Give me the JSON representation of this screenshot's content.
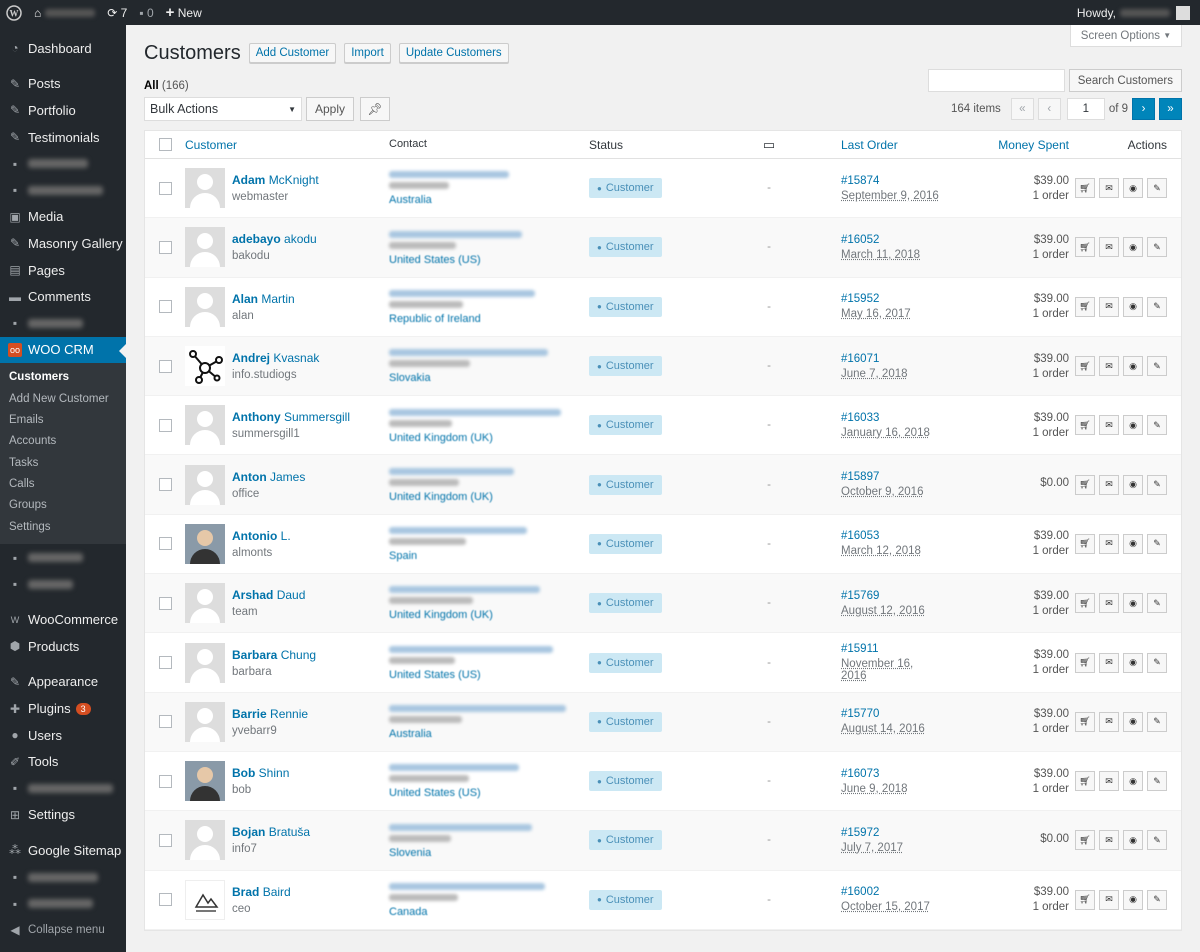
{
  "adminbar": {
    "updates_count": "7",
    "comments_count": "0",
    "new_label": "New",
    "howdy": "Howdy,"
  },
  "sidebar": {
    "items": [
      {
        "label": "Dashboard",
        "icon": "dashboard-icon"
      },
      {
        "label": "Posts",
        "icon": "pin-icon"
      },
      {
        "label": "Portfolio",
        "icon": "pin-icon"
      },
      {
        "label": "Testimonials",
        "icon": "pin-icon"
      },
      {
        "label": "Media",
        "icon": "media-icon"
      },
      {
        "label": "Masonry Gallery",
        "icon": "pin-icon"
      },
      {
        "label": "Pages",
        "icon": "pages-icon"
      },
      {
        "label": "Comments",
        "icon": "comment-icon"
      },
      {
        "label": "WOO CRM",
        "icon": "woocrm-icon"
      },
      {
        "label": "WooCommerce",
        "icon": "woo-icon"
      },
      {
        "label": "Products",
        "icon": "box-icon"
      },
      {
        "label": "Appearance",
        "icon": "brush-icon"
      },
      {
        "label": "Plugins",
        "icon": "plug-icon",
        "badge": "3"
      },
      {
        "label": "Users",
        "icon": "user-icon"
      },
      {
        "label": "Tools",
        "icon": "wrench-icon"
      },
      {
        "label": "Settings",
        "icon": "settings-icon"
      },
      {
        "label": "Google Sitemap",
        "icon": "sitemap-icon"
      },
      {
        "label": "Collapse menu",
        "icon": "collapse-icon"
      }
    ],
    "submenu": [
      "Customers",
      "Add New Customer",
      "Emails",
      "Accounts",
      "Tasks",
      "Calls",
      "Groups",
      "Settings"
    ]
  },
  "page": {
    "title": "Customers",
    "add_customer": "Add Customer",
    "import": "Import",
    "update_customers": "Update Customers",
    "screen_options": "Screen Options",
    "search_button": "Search Customers",
    "all_label": "All",
    "all_count": "(166)",
    "bulk_actions": "Bulk Actions",
    "apply": "Apply",
    "items_count": "164 items",
    "page_current": "1",
    "page_total": "of 9"
  },
  "table": {
    "headers": {
      "customer": "Customer",
      "contact": "Contact",
      "status": "Status",
      "last_order": "Last Order",
      "money_spent": "Money Spent",
      "actions": "Actions"
    },
    "rows": [
      {
        "first": "Adam",
        "last": "McKnight",
        "user": "webmaster",
        "country": "Australia",
        "status": "Customer",
        "order": "#15874",
        "date": "September 9, 2016",
        "money": "$39.00",
        "orders": "1 order",
        "avatar": "default"
      },
      {
        "first": "adebayo",
        "last": "akodu",
        "user": "bakodu",
        "country": "United States (US)",
        "status": "Customer",
        "order": "#16052",
        "date": "March 11, 2018",
        "money": "$39.00",
        "orders": "1 order",
        "avatar": "default"
      },
      {
        "first": "Alan",
        "last": "Martin",
        "user": "alan",
        "country": "Republic of Ireland",
        "status": "Customer",
        "order": "#15952",
        "date": "May 16, 2017",
        "money": "$39.00",
        "orders": "1 order",
        "avatar": "default"
      },
      {
        "first": "Andrej",
        "last": "Kvasnak",
        "user": "info.studiogs",
        "country": "Slovakia",
        "status": "Customer",
        "order": "#16071",
        "date": "June 7, 2018",
        "money": "$39.00",
        "orders": "1 order",
        "avatar": "molecule"
      },
      {
        "first": "Anthony",
        "last": "Summersgill",
        "user": "summersgill1",
        "country": "United Kingdom (UK)",
        "status": "Customer",
        "order": "#16033",
        "date": "January 16, 2018",
        "money": "$39.00",
        "orders": "1 order",
        "avatar": "default"
      },
      {
        "first": "Anton",
        "last": "James",
        "user": "office",
        "country": "United Kingdom (UK)",
        "status": "Customer",
        "order": "#15897",
        "date": "October 9, 2016",
        "money": "$0.00",
        "orders": "",
        "avatar": "default"
      },
      {
        "first": "Antonio",
        "last": "L.",
        "user": "almonts",
        "country": "Spain",
        "status": "Customer",
        "order": "#16053",
        "date": "March 12, 2018",
        "money": "$39.00",
        "orders": "1 order",
        "avatar": "photo"
      },
      {
        "first": "Arshad",
        "last": "Daud",
        "user": "team",
        "country": "United Kingdom (UK)",
        "status": "Customer",
        "order": "#15769",
        "date": "August 12, 2016",
        "money": "$39.00",
        "orders": "1 order",
        "avatar": "default"
      },
      {
        "first": "Barbara",
        "last": "Chung",
        "user": "barbara",
        "country": "United States (US)",
        "status": "Customer",
        "order": "#15911",
        "date": "November 16, 2016",
        "money": "$39.00",
        "orders": "1 order",
        "avatar": "default"
      },
      {
        "first": "Barrie",
        "last": "Rennie",
        "user": "yvebarr9",
        "country": "Australia",
        "status": "Customer",
        "order": "#15770",
        "date": "August 14, 2016",
        "money": "$39.00",
        "orders": "1 order",
        "avatar": "default"
      },
      {
        "first": "Bob",
        "last": "Shinn",
        "user": "bob",
        "country": "United States (US)",
        "status": "Customer",
        "order": "#16073",
        "date": "June 9, 2018",
        "money": "$39.00",
        "orders": "1 order",
        "avatar": "photo"
      },
      {
        "first": "Bojan",
        "last": "Bratuša",
        "user": "info7",
        "country": "Slovenia",
        "status": "Customer",
        "order": "#15972",
        "date": "July 7, 2017",
        "money": "$0.00",
        "orders": "",
        "avatar": "default"
      },
      {
        "first": "Brad",
        "last": "Baird",
        "user": "ceo",
        "country": "Canada",
        "status": "Customer",
        "order": "#16002",
        "date": "October 15, 2017",
        "money": "$39.00",
        "orders": "1 order",
        "avatar": "logo"
      }
    ]
  }
}
